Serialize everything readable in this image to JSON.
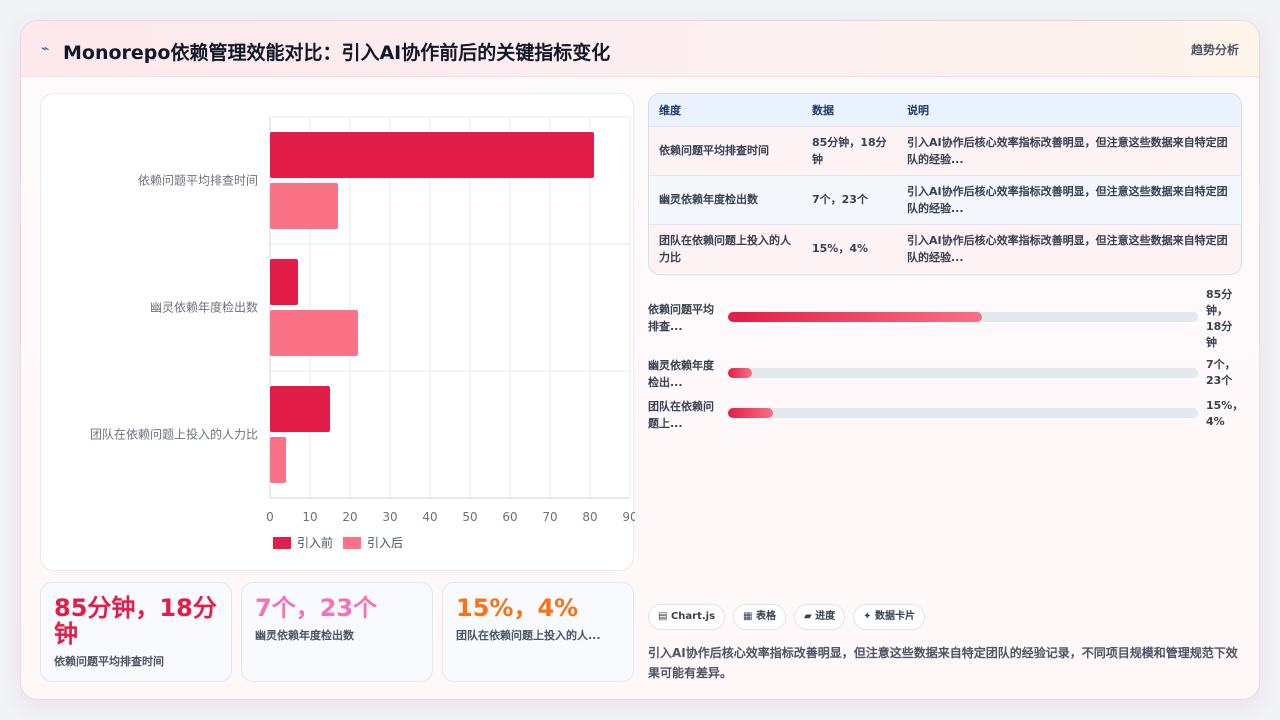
{
  "header": {
    "icon": "trend-line-icon",
    "title": "Monorepo依赖管理效能对比：引入AI协作前后的关键指标变化",
    "tag": "趋势分析"
  },
  "colors": {
    "before": "#e11d48",
    "after": "#fb7185",
    "stat1": "#e11d48",
    "stat2": "#f472b6",
    "stat3": "#f97316"
  },
  "chart_data": {
    "type": "bar",
    "orientation": "horizontal",
    "categories": [
      "依赖问题平均排查时间",
      "幽灵依赖年度检出数",
      "团队在依赖问题上投入的人力比"
    ],
    "series": [
      {
        "name": "引入前",
        "values": [
          81,
          7,
          15
        ]
      },
      {
        "name": "引入后",
        "values": [
          17,
          22,
          4
        ]
      }
    ],
    "xlim": [
      0,
      90
    ],
    "xticks": [
      "0",
      "10",
      "20",
      "30",
      "40",
      "50",
      "60",
      "70",
      "80",
      "90"
    ],
    "grid": true,
    "legend": "bottom"
  },
  "stats": [
    {
      "value": "85分钟，18分钟",
      "label": "依赖问题平均排查时间"
    },
    {
      "value": "7个，23个",
      "label": "幽灵依赖年度检出数"
    },
    {
      "value": "15%，4%",
      "label": "团队在依赖问题上投入的人..."
    }
  ],
  "table": {
    "headers": [
      "维度",
      "数据",
      "说明"
    ],
    "rows": [
      [
        "依赖问题平均排查时间",
        "85分钟，18分钟",
        "引入AI协作后核心效率指标改善明显，但注意这些数据来自特定团队的经验..."
      ],
      [
        "幽灵依赖年度检出数",
        "7个，23个",
        "引入AI协作后核心效率指标改善明显，但注意这些数据来自特定团队的经验..."
      ],
      [
        "团队在依赖问题上投入的人力比",
        "15%，4%",
        "引入AI协作后核心效率指标改善明显，但注意这些数据来自特定团队的经验..."
      ]
    ]
  },
  "progress": [
    {
      "label": "依赖问题平均排查...",
      "value": "85分钟，18分钟",
      "fraction": 0.54
    },
    {
      "label": "幽灵依赖年度检出...",
      "value": "7个，23个",
      "fraction": 0.05
    },
    {
      "label": "团队在依赖问题上...",
      "value": "15%，4%",
      "fraction": 0.095
    }
  ],
  "chips": [
    {
      "icon": "chart-icon",
      "glyph": "▤",
      "label": "Chart.js"
    },
    {
      "icon": "table-icon",
      "glyph": "▦",
      "label": "表格"
    },
    {
      "icon": "progress-icon",
      "glyph": "▰",
      "label": "进度"
    },
    {
      "icon": "sparkle-icon",
      "glyph": "✦",
      "label": "数据卡片"
    }
  ],
  "note": "引入AI协作后核心效率指标改善明显，但注意这些数据来自特定团队的经验记录，不同项目规模和管理规范下效果可能有差异。"
}
